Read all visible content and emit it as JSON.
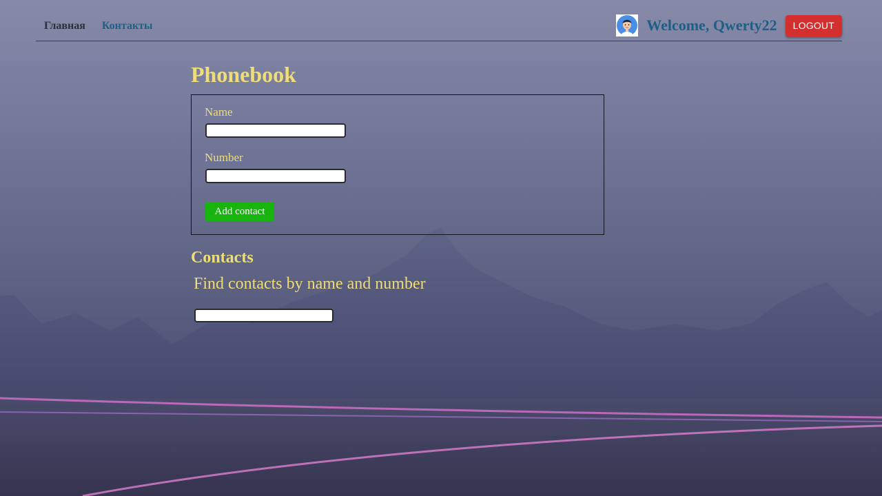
{
  "colors": {
    "accent_yellow": "#eedd78",
    "link_blue": "#1f5f86",
    "logout_red": "#d32f2f",
    "add_green": "#17b40e"
  },
  "header": {
    "nav": {
      "home_label": "Главная",
      "contacts_label": "Контакты"
    },
    "user": {
      "avatar_icon": "user-avatar-icon",
      "welcome_text": "Welcome, Qwerty22",
      "logout_label": "LOGOUT"
    }
  },
  "main": {
    "title": "Phonebook",
    "form": {
      "name_label": "Name",
      "name_value": "",
      "number_label": "Number",
      "number_value": "",
      "submit_label": "Add contact"
    },
    "contacts": {
      "title": "Contacts",
      "filter_label": "Find contacts by name and number",
      "filter_value": ""
    }
  }
}
